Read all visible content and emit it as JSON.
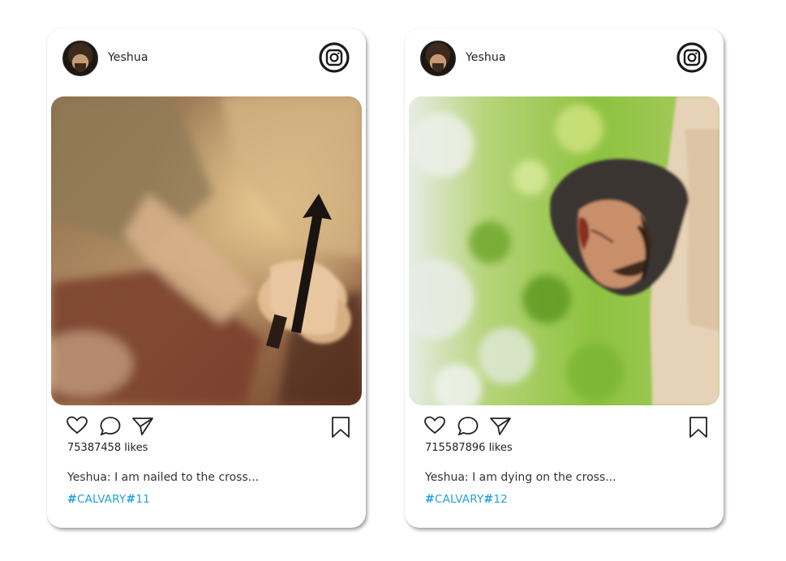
{
  "posts": [
    {
      "username": "Yeshua",
      "likes": "75387458 likes",
      "caption": "Yeshua: I am nailed to the cross...",
      "tag1": "CALVARY",
      "tag2": "11",
      "image_description": "Close-up of a hand holding a nail"
    },
    {
      "username": "Yeshua",
      "likes": "715587896 likes",
      "caption": "Yeshua: I am dying on the cross...",
      "tag1": "CALVARY",
      "tag2": "12",
      "image_description": "Statue of Jesus with crown of thorns against green leaves"
    }
  ],
  "icons": {
    "like": "heart-icon",
    "comment": "comment-icon",
    "share": "share-icon",
    "save": "bookmark-icon",
    "brand": "instagram-icon"
  },
  "colors": {
    "hashtag": "#25a0d8",
    "text": "#222222"
  }
}
